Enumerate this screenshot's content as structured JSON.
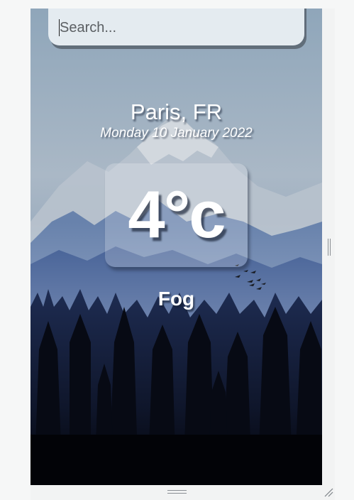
{
  "search": {
    "placeholder": "Search...",
    "value": ""
  },
  "location": {
    "city_country": "Paris, FR",
    "date": "Monday 10 January 2022"
  },
  "weather": {
    "temperature": "4°c",
    "condition": "Fog"
  },
  "icons": {
    "resize": "resize-handle-icon"
  },
  "colors": {
    "text": "#ffffff",
    "search_bg": "#ebf0f4",
    "sky_top": "#9fb4c6",
    "forest_dark": "#0a0f1c"
  }
}
